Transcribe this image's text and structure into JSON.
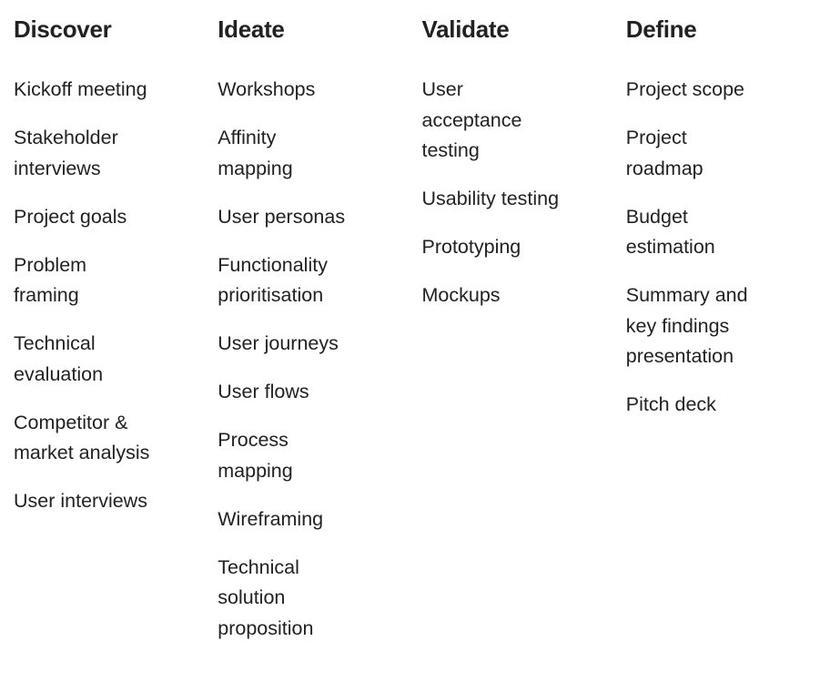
{
  "columns": [
    {
      "title": "Discover",
      "items": [
        "Kickoff meeting",
        "Stakeholder interviews",
        "Project goals",
        "Problem framing",
        "Technical evaluation",
        "Competitor & market analysis",
        "User interviews"
      ]
    },
    {
      "title": "Ideate",
      "items": [
        "Workshops",
        "Affinity mapping",
        "User personas",
        "Functionality prioritisation",
        "User journeys",
        "User flows",
        "Process mapping",
        "Wireframing",
        "Technical solution proposition"
      ]
    },
    {
      "title": "Validate",
      "items": [
        "User acceptance testing",
        "Usability testing",
        "Prototyping",
        "Mockups"
      ]
    },
    {
      "title": "Define",
      "items": [
        "Project scope",
        "Project roadmap",
        "Budget estimation",
        "Summary and key findings presentation",
        "Pitch deck"
      ]
    }
  ]
}
